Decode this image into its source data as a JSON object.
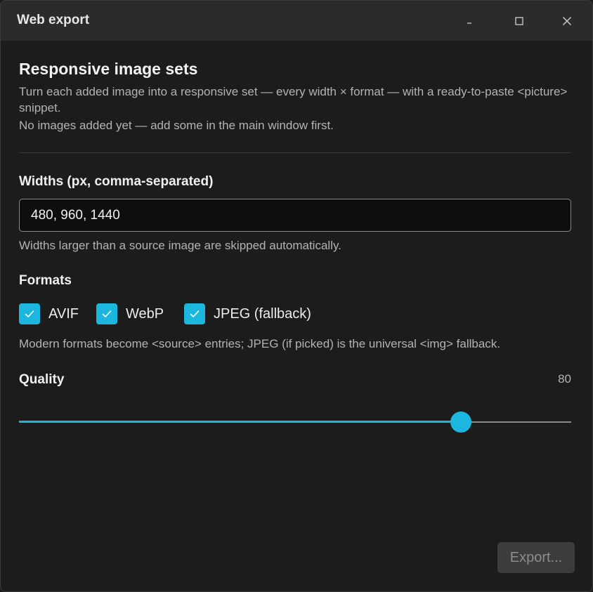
{
  "window": {
    "title": "Web export"
  },
  "header": {
    "heading": "Responsive image sets",
    "description": "Turn each added image into a responsive set — every width × format — with a ready-to-paste <picture> snippet.",
    "empty_note": "No images added yet — add some in the main window first."
  },
  "widths": {
    "label": "Widths (px, comma-separated)",
    "value": "480, 960, 1440",
    "hint": "Widths larger than a source image are skipped automatically."
  },
  "formats": {
    "label": "Formats",
    "options": [
      {
        "label": "AVIF",
        "checked": true
      },
      {
        "label": "WebP",
        "checked": true
      },
      {
        "label": "JPEG (fallback)",
        "checked": true
      }
    ],
    "hint": "Modern formats become <source> entries; JPEG (if picked) is the universal <img> fallback."
  },
  "quality": {
    "label": "Quality",
    "value": "80",
    "level": 80,
    "max": 100
  },
  "footer": {
    "export_label": "Export..."
  },
  "colors": {
    "accent": "#1bb7de",
    "background": "#1c1c1c",
    "titlebar": "#2b2b2b"
  },
  "icons": {
    "minimize": "minimize-icon",
    "maximize": "maximize-icon",
    "close": "close-icon",
    "check": "checkmark-icon"
  }
}
